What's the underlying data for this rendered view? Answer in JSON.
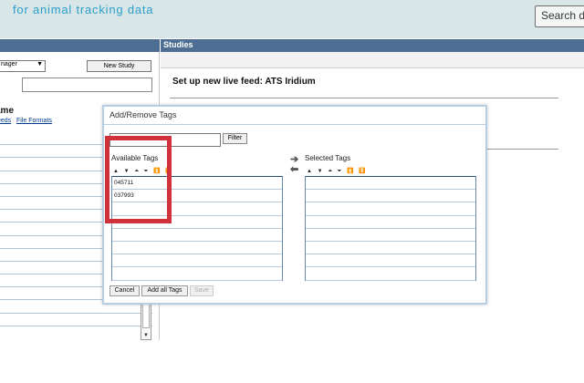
{
  "header": {
    "tagline": "for animal tracking data",
    "search_label": "Search d"
  },
  "left_panel": {
    "role_select": "nager",
    "new_study_label": "New Study",
    "name_heading": "ame",
    "feeds_link": "eeds",
    "file_formats_link": "File Formats"
  },
  "studies": {
    "header": "Studies",
    "feed_title": "Set up new live feed: ATS Iridium"
  },
  "dialog": {
    "title": "Add/Remove Tags",
    "filter_label": "Filter",
    "available_label": "Available Tags",
    "selected_label": "Selected Tags",
    "sort_icons": "▲ ▼ ⏶ ⏷ ⏫ ⏬",
    "available_tags": [
      "045711",
      "037993",
      "",
      "",
      "",
      "",
      "",
      ""
    ],
    "selected_tags": [
      "",
      "",
      "",
      "",
      "",
      "",
      "",
      ""
    ],
    "cancel_label": "Cancel",
    "add_all_label": "Add all Tags",
    "save_label": "Save"
  },
  "colors": {
    "highlight": "#d0313b",
    "header_bar": "#4e6f93",
    "tagline": "#2a9fc9"
  }
}
